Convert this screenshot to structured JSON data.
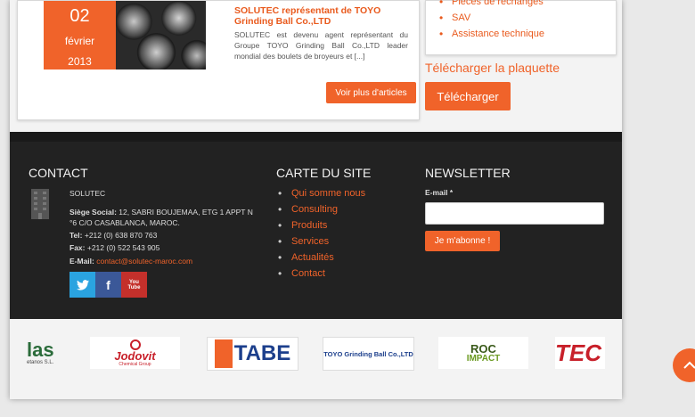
{
  "article": {
    "date_year_partial": "2013",
    "date_day": "02",
    "date_month": "février",
    "date_year": "2013",
    "title": "SOLUTEC représentant de TOYO Grinding Ball Co.,LTD",
    "excerpt": "SOLUTEC est devenu agent représentant du Groupe TOYO Grinding Ball Co.,LTD leader mondial des boulets de broyeurs et [...]",
    "more_label": "Voir plus d'articles"
  },
  "sidebar": {
    "items": [
      "Pièces de rechanges",
      "SAV",
      "Assistance technique"
    ],
    "download_title": "Télécharger la plaquette",
    "download_label": "Télécharger"
  },
  "footer": {
    "contact_title": "CONTACT",
    "company": "SOLUTEC",
    "siege_label": "Siège Social:",
    "siege_value": "12, SABRI BOUJEMAA, ETG 1 APPT N °6 C/O CASABLANCA, MAROC.",
    "tel_label": "Tel:",
    "tel_value": "+212 (0) 638 870 763",
    "fax_label": "Fax:",
    "fax_value": "+212 (0) 522 543 905",
    "email_label": "E-Mail:",
    "email_value": "contact@solutec-maroc.com",
    "sitemap_title": "CARTE DU SITE",
    "sitemap_items": [
      "Qui somme nous",
      "Consulting",
      "Produits",
      "Services",
      "Actualités",
      "Contact"
    ],
    "newsletter_title": "NEWSLETTER",
    "newsletter_field_label": "E-mail *",
    "subscribe_label": "Je m'abonne !"
  },
  "social": {
    "twitter": "t",
    "facebook": "f",
    "youtube": "You\nTube"
  },
  "logos": {
    "partial_left": "las",
    "partial_left_sub": "etanos S.L.",
    "jodovit": "Jodovit",
    "jodovit_sub": "Chemical Group",
    "tabe": "TABE",
    "toyo": "TOYO Grinding Ball Co.,LTD",
    "roc": "ROC",
    "roc_sub": "IMPACT",
    "tec": "TEC"
  },
  "colors": {
    "accent": "#f0632a",
    "footer_bg": "#222222"
  }
}
